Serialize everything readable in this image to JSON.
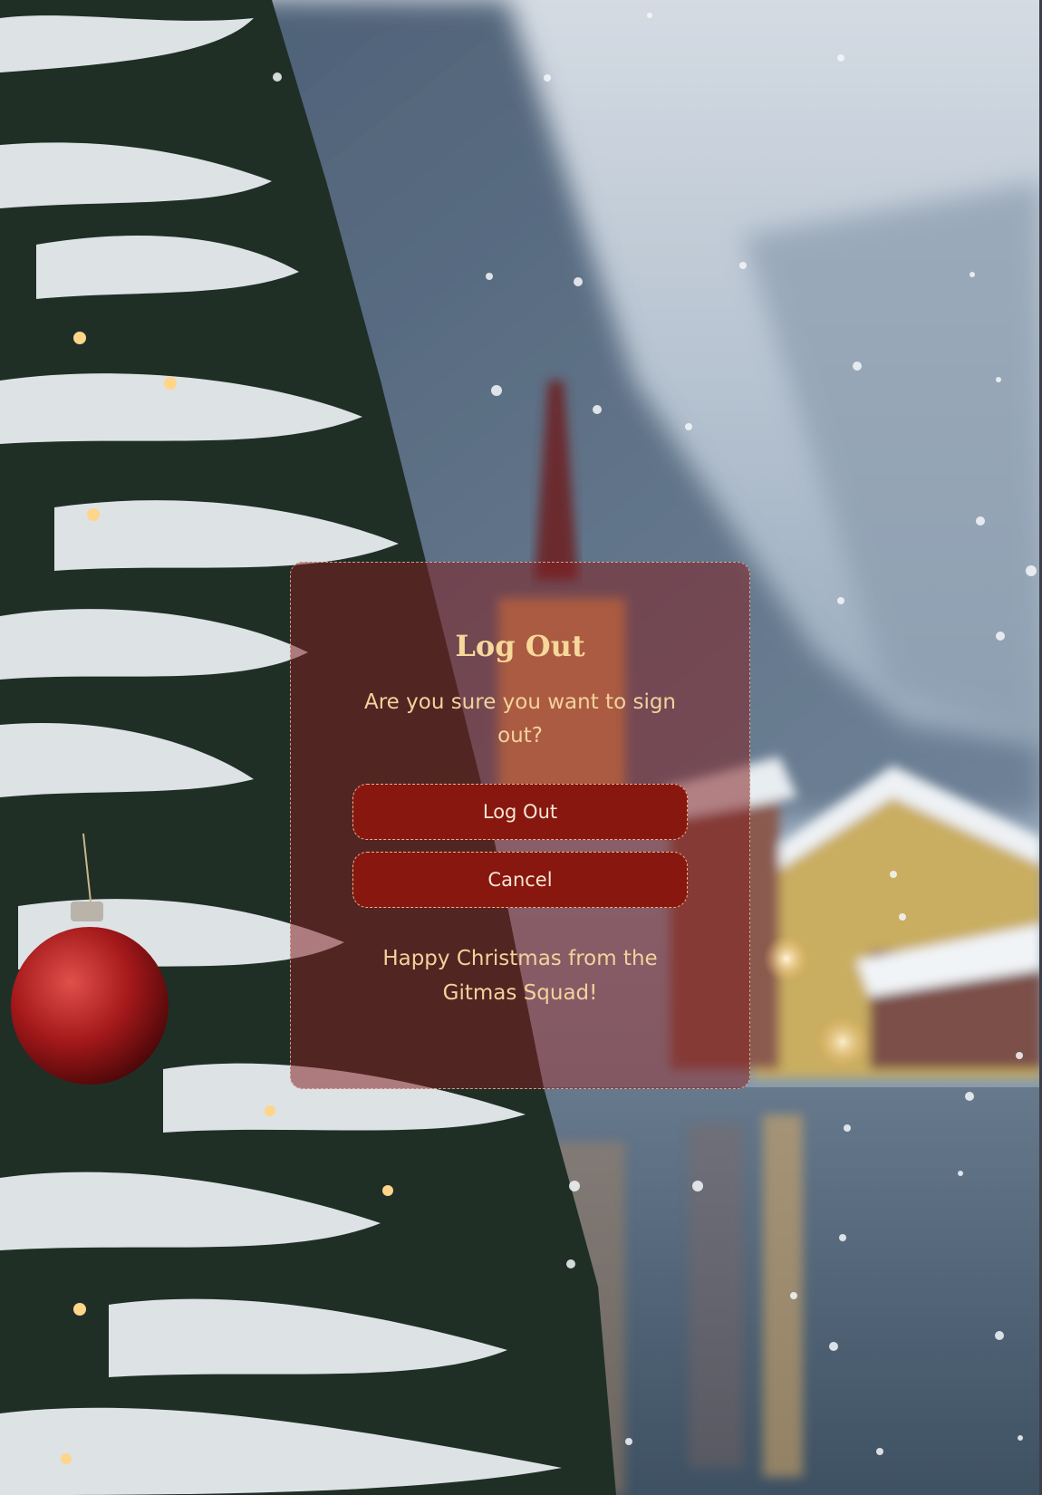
{
  "dialog": {
    "title": "Log Out",
    "message": "Are you sure you want to sign out?",
    "confirm_label": "Log Out",
    "cancel_label": "Cancel",
    "footer": "Happy Christmas from the Gitmas Squad!"
  },
  "background": {
    "description_icons": [
      "christmas-tree-icon",
      "ornament-icon",
      "snowflake-icon"
    ],
    "colors": {
      "sky": "#c5ced8",
      "mountain": "#5a6e84",
      "water": "#4f6478",
      "tree": "#24352b",
      "snow": "#eef2f5",
      "ornament": "#a11a1a"
    }
  },
  "theme": {
    "panel": "#801c1e",
    "button": "#87170f",
    "accent_text": "#f6d89a"
  }
}
